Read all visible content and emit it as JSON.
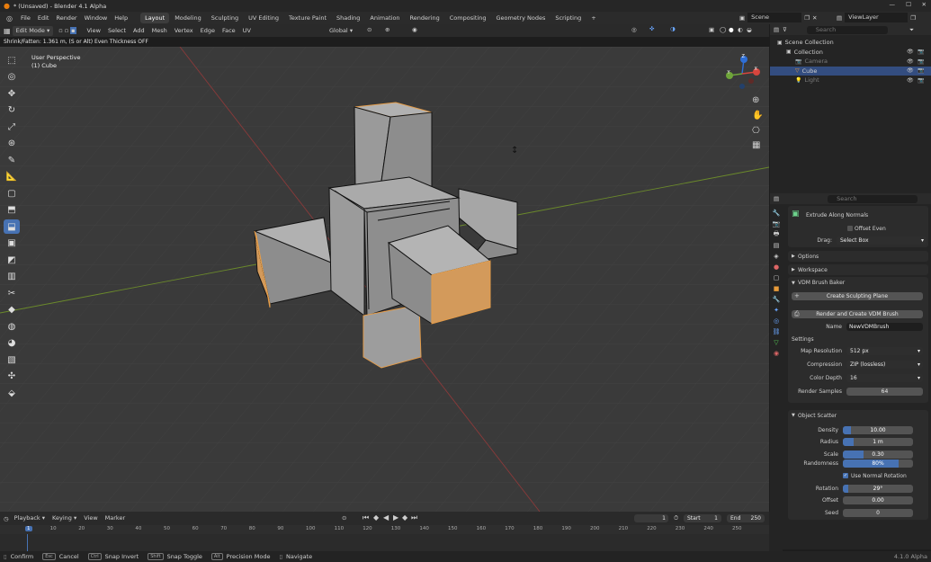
{
  "window": {
    "title": "* (Unsaved) - Blender 4.1 Alpha"
  },
  "menus": [
    "File",
    "Edit",
    "Render",
    "Window",
    "Help"
  ],
  "workspace_tabs": [
    {
      "label": "Layout",
      "active": true
    },
    {
      "label": "Modeling"
    },
    {
      "label": "Sculpting"
    },
    {
      "label": "UV Editing"
    },
    {
      "label": "Texture Paint"
    },
    {
      "label": "Shading"
    },
    {
      "label": "Animation"
    },
    {
      "label": "Rendering"
    },
    {
      "label": "Compositing"
    },
    {
      "label": "Geometry Nodes"
    },
    {
      "label": "Scripting"
    }
  ],
  "add_workspace": "+",
  "scene": {
    "label": "Scene",
    "view_layer": "ViewLayer"
  },
  "viewport_header": {
    "mode": "Edit Mode",
    "menus": [
      "View",
      "Select",
      "Add",
      "Mesh",
      "Vertex",
      "Edge",
      "Face",
      "UV"
    ],
    "orientation": "Global"
  },
  "status_hint": "Shrink/Fatten: 1.361 m, (S or Alt) Even Thickness OFF",
  "viewport": {
    "perspective": "User Perspective",
    "object": "(1) Cube",
    "gizmo": {
      "x": "X",
      "y": "Y",
      "z": "Z"
    }
  },
  "tools": [
    "cursor-select",
    "cursor",
    "move",
    "rotate",
    "scale",
    "transform",
    "annotate",
    "measure",
    "add-cube",
    "extrude",
    "inset",
    "bevel",
    "loop-cut",
    "knife",
    "poly-build",
    "spin",
    "smooth",
    "edge-slide",
    "shrink-fatten",
    "shear",
    "rip"
  ],
  "outliner": {
    "search_placeholder": "Search",
    "items": [
      {
        "label": "Scene Collection",
        "level": 0
      },
      {
        "label": "Collection",
        "level": 1
      },
      {
        "label": "Camera",
        "level": 2,
        "dim": true
      },
      {
        "label": "Cube",
        "level": 2,
        "selected": true
      },
      {
        "label": "Light",
        "level": 2,
        "dim": true
      }
    ]
  },
  "properties": {
    "search_placeholder": "Search",
    "tool_name": "Extrude Along Normals",
    "offset_even": "Offset Even",
    "drag_label": "Drag:",
    "drag_value": "Select Box",
    "options": "Options",
    "workspace": "Workspace",
    "vdm": {
      "title": "VDM Brush Baker",
      "create_plane": "Create Sculpting Plane",
      "render_create": "Render and Create VDM Brush",
      "name_label": "Name",
      "name_value": "NewVDMBrush",
      "settings": "Settings",
      "map_res_label": "Map Resolution",
      "map_res_value": "512 px",
      "compression_label": "Compression",
      "compression_value": "ZIP (lossless)",
      "color_depth_label": "Color Depth",
      "color_depth_value": "16",
      "render_samples_label": "Render Samples",
      "render_samples_value": "64"
    },
    "scatter": {
      "title": "Object Scatter",
      "density_label": "Density",
      "density_value": "10.00",
      "density_fill": 0.12,
      "radius_label": "Radius",
      "radius_value": "1 m",
      "radius_fill": 0.15,
      "scale_label": "Scale",
      "scale_value": "0.30",
      "scale_fill": 0.3,
      "randomness_label": "Randomness",
      "randomness_value": "80%",
      "randomness_fill": 0.8,
      "use_normal": "Use Normal Rotation",
      "rotation_label": "Rotation",
      "rotation_value": "29°",
      "rotation_fill": 0.08,
      "offset_label": "Offset",
      "offset_value": "0.00",
      "offset_fill": 0.0,
      "seed_label": "Seed",
      "seed_value": "0"
    }
  },
  "timeline": {
    "menus": [
      "Playback",
      "Keying",
      "View",
      "Marker"
    ],
    "current_frame": "1",
    "start_label": "Start",
    "start": "1",
    "end_label": "End",
    "end": "250",
    "ticks": [
      "1",
      "10",
      "20",
      "30",
      "40",
      "50",
      "60",
      "70",
      "80",
      "90",
      "100",
      "110",
      "120",
      "130",
      "140",
      "150",
      "160",
      "170",
      "180",
      "190",
      "200",
      "210",
      "220",
      "230",
      "240",
      "250"
    ]
  },
  "statusbar": {
    "items": [
      "Confirm",
      "Cancel",
      "Snap Invert",
      "Snap Toggle",
      "Precision Mode",
      "Navigate"
    ],
    "keys": [
      "Esc",
      "Ctrl",
      "Shift",
      "Alt"
    ],
    "version": "4.1.0 Alpha"
  },
  "colors": {
    "accent": "#4772b3",
    "selected_face": "#d39a5b",
    "viewport_bg": "#3a3a3a"
  }
}
